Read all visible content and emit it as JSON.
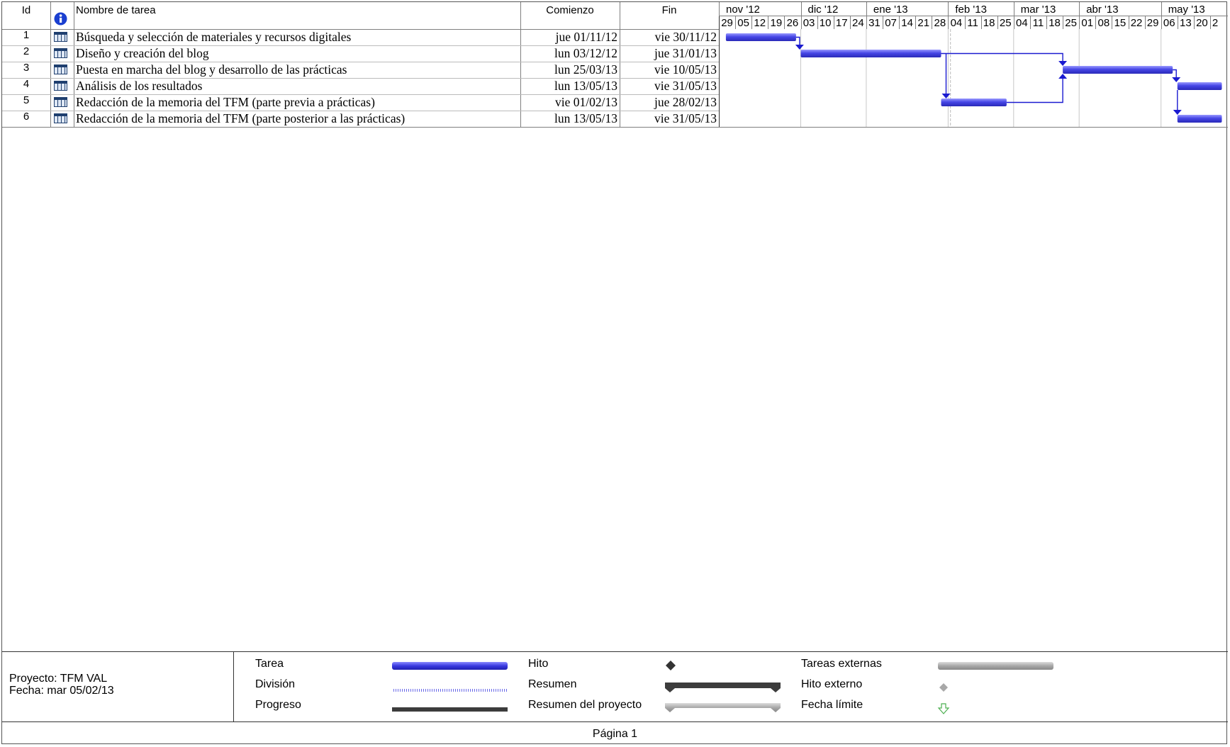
{
  "header": {
    "id": "Id",
    "name": "Nombre de tarea",
    "start": "Comienzo",
    "end": "Fin"
  },
  "timeline": {
    "months": [
      "nov '12",
      "dic '12",
      "ene '13",
      "feb '13",
      "mar '13",
      "abr '13",
      "may '13"
    ],
    "days": [
      "29",
      "05",
      "12",
      "19",
      "26",
      "03",
      "10",
      "17",
      "24",
      "31",
      "07",
      "14",
      "21",
      "28",
      "04",
      "11",
      "18",
      "25",
      "04",
      "11",
      "18",
      "25",
      "01",
      "08",
      "15",
      "22",
      "29",
      "06",
      "13",
      "20",
      "2"
    ]
  },
  "tasks": [
    {
      "id": "1",
      "name": "Búsqueda y selección de materiales y recursos digitales",
      "start": "jue 01/11/12",
      "end": "vie 30/11/12"
    },
    {
      "id": "2",
      "name": "Diseño y creación del blog",
      "start": "lun 03/12/12",
      "end": "jue 31/01/13"
    },
    {
      "id": "3",
      "name": "Puesta en marcha del blog y desarrollo de las prácticas",
      "start": "lun 25/03/13",
      "end": "vie 10/05/13"
    },
    {
      "id": "4",
      "name": "Análisis de los resultados",
      "start": "lun 13/05/13",
      "end": "vie 31/05/13"
    },
    {
      "id": "5",
      "name": "Redacción de la memoria del TFM (parte previa a prácticas)",
      "start": "vie 01/02/13",
      "end": "jue 28/02/13"
    },
    {
      "id": "6",
      "name": "Redacción de la memoria del TFM (parte posterior a las prácticas)",
      "start": "lun 13/05/13",
      "end": "vie 31/05/13"
    }
  ],
  "footer": {
    "project": "Proyecto: TFM VAL",
    "date": "Fecha: mar 05/02/13",
    "page": "Página 1"
  },
  "legend": {
    "task": "Tarea",
    "split": "División",
    "progress": "Progreso",
    "milestone": "Hito",
    "summary": "Resumen",
    "project_summary": "Resumen del proyecto",
    "external_tasks": "Tareas externas",
    "external_milestone": "Hito externo",
    "deadline": "Fecha límite"
  },
  "colors": {
    "task_bar": "#4646e6",
    "link": "#1a1ad0",
    "grid": "#c8c8c8"
  }
}
